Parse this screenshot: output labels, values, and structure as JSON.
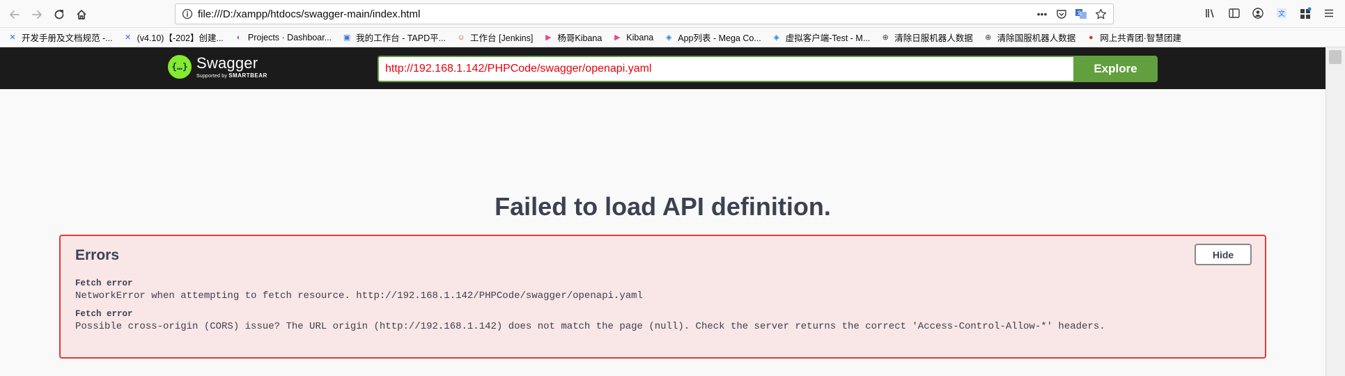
{
  "browser": {
    "url": "file:///D:/xampp/htdocs/swagger-main/index.html",
    "bookmarks": [
      {
        "label": "开发手册及文档规范 -...",
        "icon": "confluence-icon",
        "color": "#1f6feb"
      },
      {
        "label": "(v4.10)【-202】创建...",
        "icon": "confluence-icon",
        "color": "#1f6feb"
      },
      {
        "label": "Projects · Dashboar...",
        "icon": "gitlab-icon",
        "color": "#9b59b6"
      },
      {
        "label": "我的工作台 - TAPD平...",
        "icon": "tapd-icon",
        "color": "#3b73d8"
      },
      {
        "label": "工作台 [Jenkins]",
        "icon": "jenkins-icon",
        "color": "#d24939"
      },
      {
        "label": "杨哥Kibana",
        "icon": "kibana-icon",
        "color": "#e8478b"
      },
      {
        "label": "Kibana",
        "icon": "kibana-icon",
        "color": "#e8478b"
      },
      {
        "label": "App列表 - Mega Co...",
        "icon": "shield-icon",
        "color": "#2c8ad9"
      },
      {
        "label": "虚拟客户端-Test - M...",
        "icon": "shield-icon",
        "color": "#2c8ad9"
      },
      {
        "label": "清除日服机器人数据",
        "icon": "globe-icon",
        "color": "#444444"
      },
      {
        "label": "清除国服机器人数据",
        "icon": "globe-icon",
        "color": "#444444"
      },
      {
        "label": "网上共青团·智慧团建",
        "icon": "emblem-icon",
        "color": "#d63a1e"
      }
    ]
  },
  "swagger": {
    "logo_name": "Swagger",
    "logo_supported": "Supported by",
    "logo_brand": "SMARTBEAR",
    "spec_url": "http://192.168.1.142/PHPCode/swagger/openapi.yaml",
    "explore_label": "Explore"
  },
  "main": {
    "title": "Failed to load API definition.",
    "errors_title": "Errors",
    "hide_label": "Hide",
    "errors": [
      {
        "label": "Fetch error",
        "message": "NetworkError when attempting to fetch resource. http://192.168.1.142/PHPCode/swagger/openapi.yaml"
      },
      {
        "label": "Fetch error",
        "message": "Possible cross-origin (CORS) issue? The URL origin (http://192.168.1.142) does not match the page (null). Check the server returns the correct 'Access-Control-Allow-*' headers."
      }
    ]
  }
}
